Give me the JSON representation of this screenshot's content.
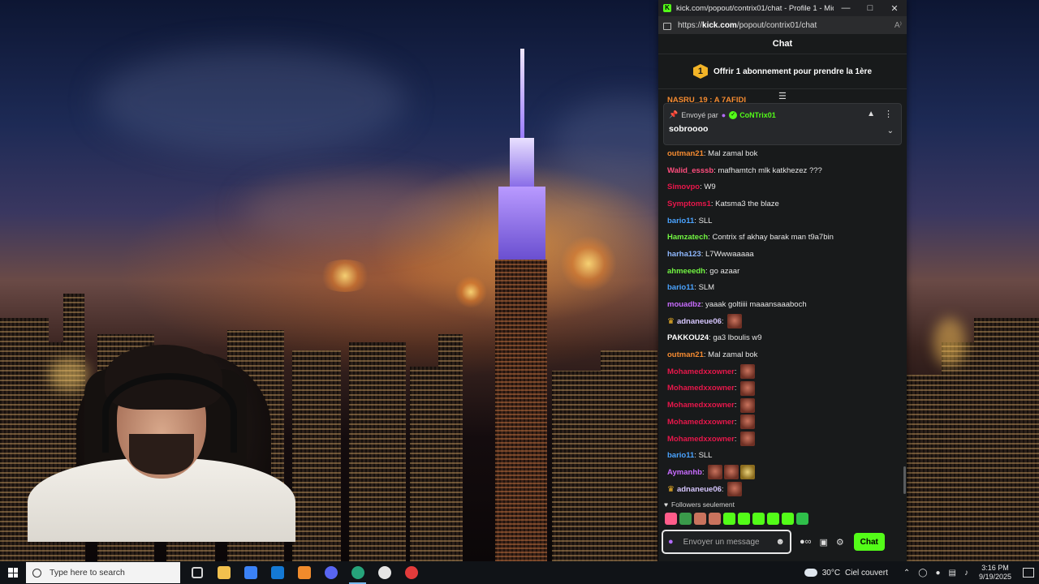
{
  "browser": {
    "title": "kick.com/popout/contrix01/chat - Profile 1 - Microsof...",
    "url_prefix": "https://",
    "url_domain": "kick.com",
    "url_path": "/popout/contrix01/chat",
    "reader_label": "A⁾"
  },
  "chat": {
    "header": "Chat",
    "sub_banner_count": "1",
    "sub_banner_text": "Offrir 1 abonnement pour prendre la 1ère",
    "cut_line": "NASRU_19 : A 7AFIDI",
    "pinned": {
      "sent_by": "Envoyé par",
      "user": "CoNTrix01",
      "message": "sobroooo"
    },
    "messages": [
      {
        "user": "outman21",
        "color": "#f58b31",
        "text": "Mal zamal bok",
        "emotes": 0
      },
      {
        "user": "Walid_esssb",
        "color": "#ff4d7d",
        "text": "mafhamtch mlk katkhezez ???",
        "emotes": 0
      },
      {
        "user": "Simovpo",
        "color": "#e8174b",
        "text": "W9",
        "emotes": 0
      },
      {
        "user": "Symptoms1",
        "color": "#e8174b",
        "text": "Katsma3 the blaze",
        "emotes": 0
      },
      {
        "user": "bario11",
        "color": "#4aa3ff",
        "text": "SLL",
        "emotes": 0
      },
      {
        "user": "Hamzatech",
        "color": "#72f542",
        "text": "Contrix sf akhay barak man t9a7bin",
        "emotes": 0
      },
      {
        "user": "harha123",
        "color": "#8fb8ff",
        "text": "L7Wwwaaaaa",
        "emotes": 0
      },
      {
        "user": "ahmeeedh",
        "color": "#72f542",
        "text": "go azaar",
        "emotes": 0
      },
      {
        "user": "bario11",
        "color": "#4aa3ff",
        "text": "SLM",
        "emotes": 0
      },
      {
        "user": "mouadbz",
        "color": "#c86cff",
        "text": "yaaak goltiiii maaansaaaboch",
        "emotes": 0
      },
      {
        "user": "adnaneue06",
        "color": "#d7c7ff",
        "text": "",
        "emotes": 1,
        "crown": true
      },
      {
        "user": "PAKKOU24",
        "color": "#ffffff",
        "text": "ga3 lboulis w9",
        "emotes": 0
      },
      {
        "user": "outman21",
        "color": "#f58b31",
        "text": "Mal zamal bok",
        "emotes": 0
      },
      {
        "user": "Mohamedxxowner",
        "color": "#e8174b",
        "text": "",
        "emotes": 1
      },
      {
        "user": "Mohamedxxowner",
        "color": "#e8174b",
        "text": "",
        "emotes": 1
      },
      {
        "user": "Mohamedxxowner",
        "color": "#e8174b",
        "text": "",
        "emotes": 1
      },
      {
        "user": "Mohamedxxowner",
        "color": "#e8174b",
        "text": "",
        "emotes": 1
      },
      {
        "user": "Mohamedxxowner",
        "color": "#e8174b",
        "text": "",
        "emotes": 1
      },
      {
        "user": "bario11",
        "color": "#4aa3ff",
        "text": "SLL",
        "emotes": 0
      },
      {
        "user": "Aymanhb",
        "color": "#c86cff",
        "text": "",
        "emotes": 2,
        "fly": true
      },
      {
        "user": "adnaneue06",
        "color": "#d7c7ff",
        "text": "",
        "emotes": 1,
        "crown": true
      }
    ],
    "followers_only": "Followers seulement",
    "emote_bar_colors": [
      "#ff5c8a",
      "#3a9a4a",
      "#c9735d",
      "#c9735d",
      "#53fc18",
      "#53fc18",
      "#53fc18",
      "#53fc18",
      "#53fc18",
      "#2fbf4a"
    ],
    "input_placeholder": "Envoyer un message",
    "send_button": "Chat"
  },
  "taskbar": {
    "search_placeholder": "Type here to search",
    "app_icons": [
      {
        "name": "task-view-icon",
        "color": "#d6d6d6"
      },
      {
        "name": "file-explorer-icon",
        "color": "#f2c14e"
      },
      {
        "name": "microsoft-store-icon",
        "color": "#3b82f6"
      },
      {
        "name": "outlook-icon",
        "color": "#1479d4"
      },
      {
        "name": "app-orange-icon",
        "color": "#f08b2c"
      },
      {
        "name": "discord-icon",
        "color": "#5865f2"
      },
      {
        "name": "edge-icon",
        "color": "#26a37a"
      },
      {
        "name": "obs-icon",
        "color": "#e5e5e5"
      },
      {
        "name": "record-icon",
        "color": "#e33b3b"
      }
    ],
    "weather_temp": "30°C",
    "weather_text": "Ciel couvert",
    "time": "3:16 PM",
    "date": "9/19/2025"
  }
}
